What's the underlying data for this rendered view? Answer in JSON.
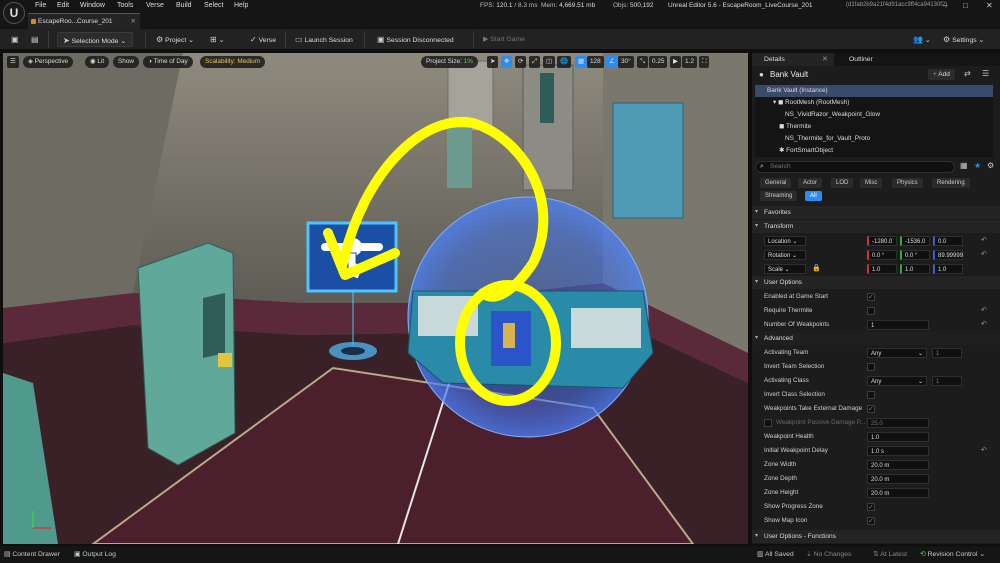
{
  "menubar": {
    "items": [
      "File",
      "Edit",
      "Window",
      "Tools",
      "Verse",
      "Build",
      "Select",
      "Help"
    ],
    "fps_label": "FPS:",
    "fps": "120.1",
    "ms": "8.3 ms",
    "mem_label": "Mem:",
    "mem": "4,669.51 mb",
    "objs_label": "Objs:",
    "objs": "500,192",
    "title": "Unreal Editor 5.6 - EscapeRoom_LiveCourse_201",
    "hash": "(d1fab2b9a21f4d91acc9ff4ca94130f2)"
  },
  "tab": {
    "label": "EscapeRoo...Course_201"
  },
  "toolbar": {
    "selection_mode": "Selection Mode",
    "project": "Project",
    "verse": "Verse",
    "launch_session": "Launch Session",
    "session_status": "Session Disconnected",
    "start_game": "Start Game",
    "settings": "Settings"
  },
  "viewport": {
    "perspective": "Perspective",
    "lit": "Lit",
    "show": "Show",
    "time_of_day": "Time of Day",
    "scalability": "Scalability: Medium",
    "project_size_label": "Project Size:",
    "project_size": "1%",
    "grid": "128",
    "angle": "30°",
    "scale": "0.25",
    "speed": "1.2"
  },
  "details": {
    "tab_details": "Details",
    "tab_outliner": "Outliner",
    "actor_name": "Bank Vault",
    "add_label": "Add",
    "tree": [
      "Bank Vault (Instance)",
      "RootMesh (RootMesh)",
      "NS_VividRazor_Weakpoint_Glow",
      "Thermite",
      "NS_Thermite_for_Vault_Proto",
      "FortSmartObject"
    ],
    "search_placeholder": "Search",
    "filters_row1": [
      "General",
      "Actor",
      "LOD",
      "Misc",
      "Physics",
      "Rendering"
    ],
    "filters_row2": [
      "Streaming",
      "All"
    ],
    "sections": {
      "favorites": "Favorites",
      "transform": "Transform",
      "user_options": "User Options",
      "advanced": "Advanced",
      "user_options_functions": "User Options - Functions"
    },
    "transform": {
      "location_label": "Location",
      "location": [
        "-1280.0",
        "-1536.0",
        "0.0"
      ],
      "rotation_label": "Rotation",
      "rotation": [
        "0.0 °",
        "0.0 °",
        "89.99999"
      ],
      "scale_label": "Scale",
      "scale": [
        "1.0",
        "1.0",
        "1.0"
      ]
    },
    "user_options": {
      "enabled_at_game_start": "Enabled at Game Start",
      "require_thermite": "Require Thermite",
      "number_of_weakpoints_label": "Number Of Weakpoints",
      "number_of_weakpoints": "1"
    },
    "advanced": {
      "activating_team_label": "Activating Team",
      "activating_team": "Any",
      "activating_team_num": "1",
      "invert_team_selection": "Invert Team Selection",
      "activating_class_label": "Activating Class",
      "activating_class": "Any",
      "activating_class_num": "1",
      "invert_class_selection": "Invert Class Selection",
      "weakpoints_take_external_damage": "Weakpoints Take External Damage",
      "weakpoint_passive_damage_label": "Weakpoint Passive Damage P...",
      "weakpoint_passive_damage": "25.0",
      "weakpoint_health_label": "Weakpoint Health",
      "weakpoint_health": "1.0",
      "initial_weakpoint_delay_label": "Initial Weakpoint Delay",
      "initial_weakpoint_delay": "1.0 s",
      "zone_width_label": "Zone Width",
      "zone_width": "20.0 m",
      "zone_depth_label": "Zone Depth",
      "zone_depth": "20.0 m",
      "zone_height_label": "Zone Height",
      "zone_height": "20.0 m",
      "show_progress_zone": "Show Progress Zone",
      "show_map_icon": "Show Map Icon"
    }
  },
  "statusbar": {
    "content_drawer": "Content Drawer",
    "output_log": "Output Log",
    "all_saved": "All Saved",
    "no_changes": "No Changes",
    "at_latest": "At Latest",
    "revision_control": "Revision Control"
  },
  "colors": {
    "accent": "#2d8cf0",
    "annotation": "#ffff00",
    "scalability": "#e8c84a"
  }
}
